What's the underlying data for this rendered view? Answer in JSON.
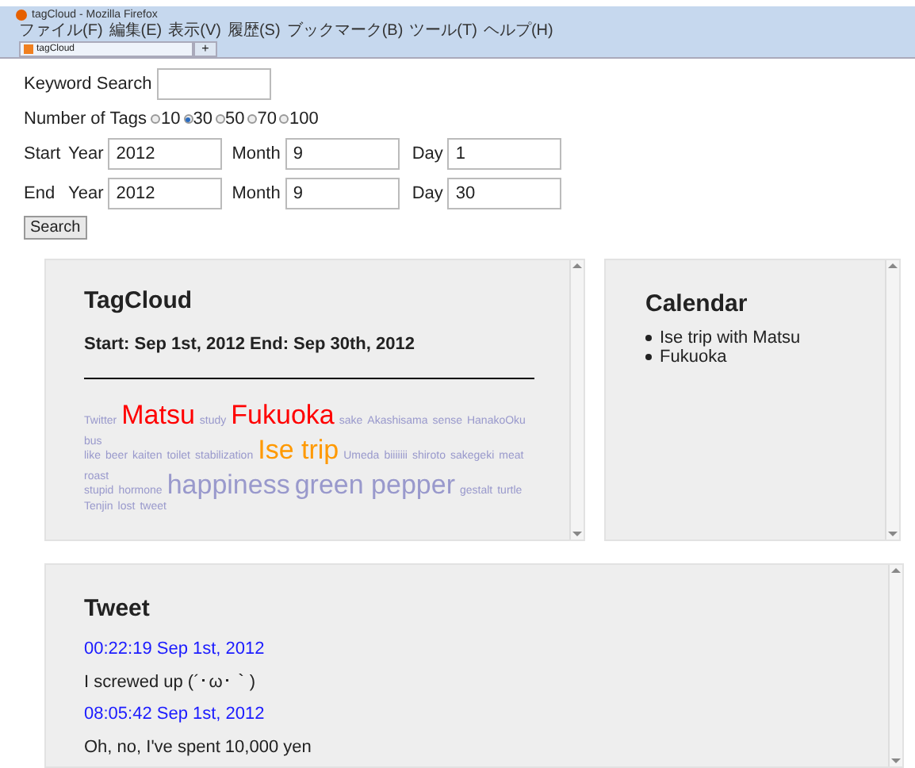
{
  "window": {
    "title": "tagCloud - Mozilla Firefox"
  },
  "menu": [
    "ファイル(F)",
    "編集(E)",
    "表示(V)",
    "履歴(S)",
    "ブックマーク(B)",
    "ツール(T)",
    "ヘルプ(H)"
  ],
  "tabs": [
    {
      "label": "tagCloud",
      "selected": true
    }
  ],
  "new_tab": "+",
  "form": {
    "keyword_label": "Keyword Search",
    "tags_label": "Number of Tags",
    "tag_options": [
      {
        "label": "10",
        "selected": false
      },
      {
        "label": "30",
        "selected": true
      },
      {
        "label": "50",
        "selected": false
      },
      {
        "label": "70",
        "selected": false
      },
      {
        "label": "100",
        "selected": false
      }
    ],
    "dates": [
      {
        "label": "Start",
        "year_label": "Year",
        "year": "2012",
        "month_label": "Month",
        "month": "9",
        "day_label": "Day",
        "day": "1"
      },
      {
        "label": "End",
        "year_label": "Year",
        "year": "2012",
        "month_label": "Month",
        "month": "9",
        "day_label": "Day",
        "day": "30"
      }
    ],
    "search_button": "Search"
  },
  "tagcloud": {
    "title": "TagCloud",
    "range": "Start: Sep 1st, 2012 End: Sep 30th, 2012",
    "lines": [
      [
        {
          "text": "Twitter",
          "kind": "small",
          "color": "#9999cc"
        },
        {
          "text": "Matsu",
          "kind": "large",
          "color": "#ff0000"
        },
        {
          "text": "study",
          "kind": "small",
          "color": "#9999cc"
        },
        {
          "text": "Fukuoka",
          "kind": "large",
          "color": "#ff0000"
        },
        {
          "text": "sake",
          "kind": "small",
          "color": "#9999cc"
        },
        {
          "text": "Akashisama",
          "kind": "small",
          "color": "#9999cc"
        },
        {
          "text": "sense",
          "kind": "small",
          "color": "#9999cc"
        },
        {
          "text": "HanakoOku",
          "kind": "small",
          "color": "#9999cc"
        },
        {
          "text": "bus",
          "kind": "small",
          "color": "#9999cc"
        }
      ],
      [
        {
          "text": "like",
          "kind": "small",
          "color": "#9999cc"
        },
        {
          "text": "beer",
          "kind": "small",
          "color": "#9999cc"
        },
        {
          "text": "kaiten",
          "kind": "small",
          "color": "#9999cc"
        },
        {
          "text": "toilet",
          "kind": "small",
          "color": "#9999cc"
        },
        {
          "text": "stabilization",
          "kind": "small",
          "color": "#9999cc"
        },
        {
          "text": "Ise trip",
          "kind": "large",
          "color": "#ff9900"
        },
        {
          "text": "Umeda",
          "kind": "small",
          "color": "#9999cc"
        },
        {
          "text": "biiiiiii",
          "kind": "small",
          "color": "#9999cc"
        },
        {
          "text": "shiroto",
          "kind": "small",
          "color": "#9999cc"
        },
        {
          "text": "sakegeki",
          "kind": "small",
          "color": "#9999cc"
        },
        {
          "text": "meat",
          "kind": "small",
          "color": "#9999cc"
        },
        {
          "text": "roast",
          "kind": "small",
          "color": "#9999cc"
        }
      ],
      [
        {
          "text": "stupid",
          "kind": "small",
          "color": "#9999cc"
        },
        {
          "text": "hormone",
          "kind": "small",
          "color": "#9999cc"
        },
        {
          "text": "happiness",
          "kind": "large",
          "color": "#9999cc"
        },
        {
          "text": "green pepper",
          "kind": "large",
          "color": "#9999cc"
        },
        {
          "text": "gestalt",
          "kind": "small",
          "color": "#9999cc"
        },
        {
          "text": "turtle",
          "kind": "small",
          "color": "#9999cc"
        }
      ],
      [
        {
          "text": "Tenjin",
          "kind": "small",
          "color": "#9999cc"
        },
        {
          "text": "lost",
          "kind": "small",
          "color": "#9999cc"
        },
        {
          "text": "tweet",
          "kind": "small",
          "color": "#9999cc"
        }
      ]
    ]
  },
  "calendar": {
    "title": "Calendar",
    "items": [
      "Ise trip with Matsu",
      "Fukuoka"
    ]
  },
  "tweet": {
    "title": "Tweet",
    "entries": [
      {
        "time": "00:22:19 Sep 1st, 2012",
        "text": "I screwed up (´･ω･｀)"
      },
      {
        "time": "08:05:42 Sep 1st, 2012",
        "text": "Oh, no, I've spent 10,000 yen"
      }
    ]
  }
}
